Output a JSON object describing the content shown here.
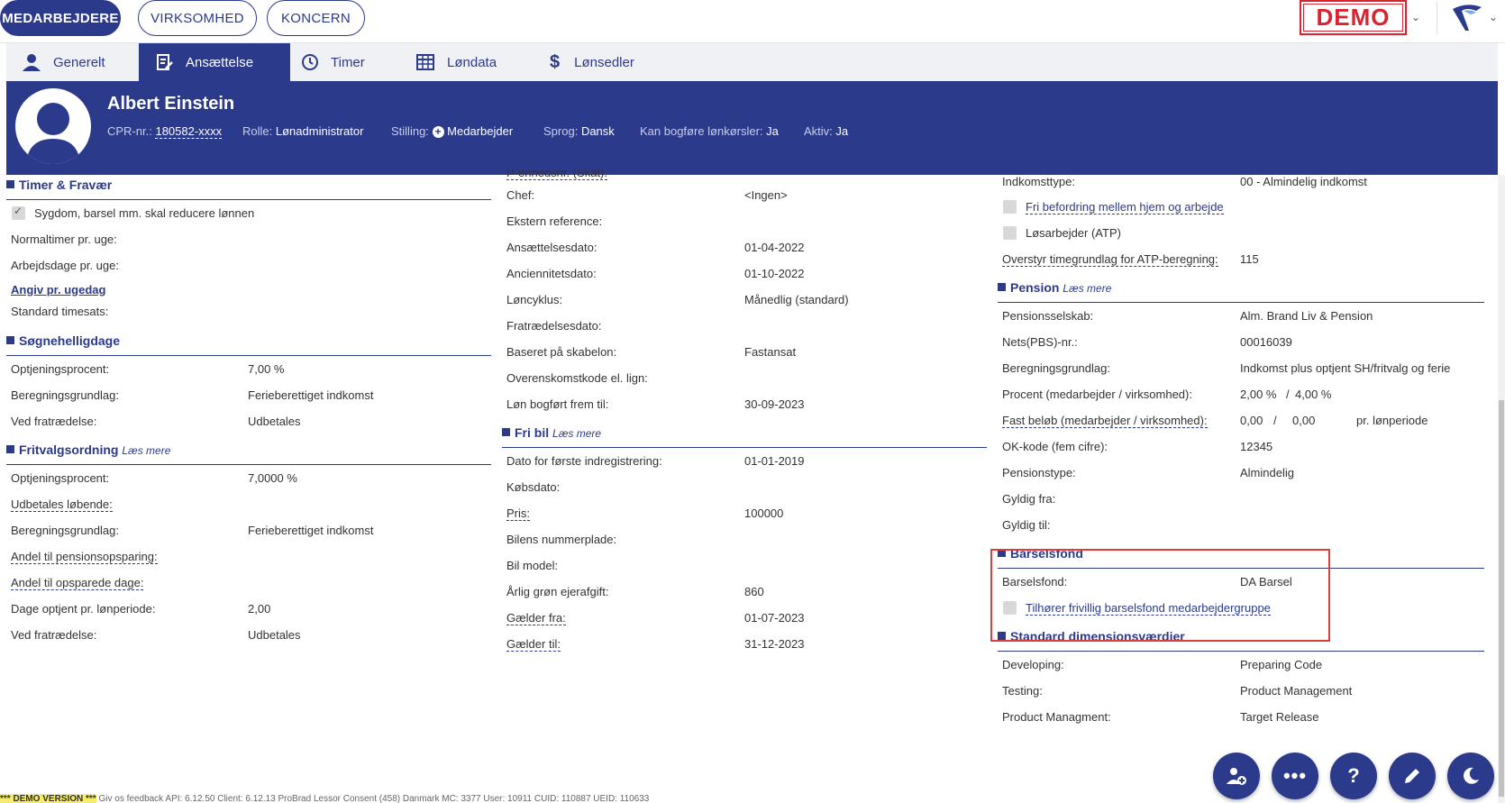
{
  "topnav": {
    "items": [
      "MEDARBEJDERE",
      "VIRKSOMHED",
      "KONCERN"
    ],
    "demo_label": "DEMO"
  },
  "tabs": [
    "Generelt",
    "Ansættelse",
    "Timer",
    "Løndata",
    "Lønsedler"
  ],
  "employee": {
    "name": "Albert Einstein",
    "cpr_label": "CPR-nr.:",
    "cpr_value": "180582-xxxx",
    "role_label": "Rolle:",
    "role_value": "Lønadministrator",
    "position_label": "Stilling:",
    "position_value": "Medarbejder",
    "language_label": "Sprog:",
    "language_value": "Dansk",
    "bookkeep_label": "Kan bogføre lønkørsler:",
    "bookkeep_value": "Ja",
    "active_label": "Aktiv:",
    "active_value": "Ja"
  },
  "col1": {
    "timer": {
      "title": "Timer & Fravær",
      "sick_checkbox": "Sygdom, barsel mm. skal reducere lønnen",
      "normal_hours": "Normaltimer pr. uge:",
      "work_days": "Arbejdsdage pr. uge:",
      "weekday_link": "Angiv pr. ugedag",
      "std_rate": "Standard timesats:"
    },
    "sh": {
      "title": "Søgnehelligdage",
      "rows": [
        {
          "label": "Optjeningsprocent:",
          "value": "7,00 %"
        },
        {
          "label": "Beregningsgrundlag:",
          "value": "Ferieberettiget indkomst"
        },
        {
          "label": "Ved fratrædelse:",
          "value": "Udbetales"
        }
      ]
    },
    "fritvalg": {
      "title": "Fritvalgsordning",
      "read_more": "Læs mere",
      "rows": [
        {
          "label": "Optjeningsprocent:",
          "value": "7,0000 %"
        },
        {
          "label": "Udbetales løbende:",
          "value": ""
        },
        {
          "label": "Beregningsgrundlag:",
          "value": "Ferieberettiget indkomst"
        },
        {
          "label": "Andel til pensionsopsparing:",
          "value": ""
        },
        {
          "label": "Andel til opsparede dage:",
          "value": ""
        },
        {
          "label": "Dage optjent pr. lønperiode:",
          "value": "2,00"
        },
        {
          "label": "Ved fratrædelse:",
          "value": "Udbetales"
        }
      ]
    }
  },
  "col2": {
    "employment": {
      "cut_label": "P-enhedsnr. (Skat):",
      "rows": [
        {
          "label": "Chef:",
          "value": "<Ingen>"
        },
        {
          "label": "Ekstern reference:",
          "value": ""
        },
        {
          "label": "Ansættelsesdato:",
          "value": "01-04-2022"
        },
        {
          "label": "Anciennitetsdato:",
          "value": "01-10-2022"
        },
        {
          "label": "Løncyklus:",
          "value": "Månedlig (standard)"
        },
        {
          "label": "Fratrædelsesdato:",
          "value": ""
        },
        {
          "label": "Baseret på skabelon:",
          "value": "Fastansat"
        },
        {
          "label": "Overenskomstkode el. lign:",
          "value": ""
        },
        {
          "label": "Løn bogført frem til:",
          "value": "30-09-2023"
        }
      ]
    },
    "car": {
      "title": "Fri bil",
      "read_more": "Læs mere",
      "rows": [
        {
          "label": "Dato for første indregistrering:",
          "value": "01-01-2019"
        },
        {
          "label": "Købsdato:",
          "value": ""
        },
        {
          "label": "Pris:",
          "value": "100000"
        },
        {
          "label": "Bilens nummerplade:",
          "value": ""
        },
        {
          "label": "Bil model:",
          "value": ""
        },
        {
          "label": "Årlig grøn ejerafgift:",
          "value": "860"
        },
        {
          "label": "Gælder fra:",
          "value": "01-07-2023"
        },
        {
          "label": "Gælder til:",
          "value": "31-12-2023"
        }
      ]
    }
  },
  "col3": {
    "income": {
      "type_label": "Indkomsttype:",
      "type_value": "00 - Almindelig indkomst",
      "free_transport": "Fri befordring mellem hjem og arbejde",
      "casual_worker": "Løsarbejder (ATP)",
      "atp_label": "Overstyr timegrundlag for ATP-beregning:",
      "atp_value": "115"
    },
    "pension": {
      "title": "Pension",
      "read_more": "Læs mere",
      "company_label": "Pensionsselskab:",
      "company_value": "Alm. Brand Liv & Pension",
      "nets_label": "Nets(PBS)-nr.:",
      "nets_value": "00016039",
      "basis_label": "Beregningsgrundlag:",
      "basis_value": "Indkomst plus optjent SH/fritvalg og ferie",
      "pct_label": "Procent (medarbejder / virksomhed):",
      "pct_emp": "2,00 %",
      "pct_sep": "/",
      "pct_comp": "4,00 %",
      "fixed_label": "Fast beløb (medarbejder / virksomhed):",
      "fixed_emp": "0,00",
      "fixed_sep": "/",
      "fixed_comp": "0,00",
      "fixed_period": "pr. lønperiode",
      "ok_label": "OK-kode (fem cifre):",
      "ok_value": "12345",
      "ptype_label": "Pensionstype:",
      "ptype_value": "Almindelig",
      "from_label": "Gyldig fra:",
      "to_label": "Gyldig til:"
    },
    "maternity": {
      "title": "Barselsfond",
      "fund_label": "Barselsfond:",
      "fund_value": "DA Barsel",
      "voluntary": "Tilhører frivillig barselsfond medarbejdergruppe"
    },
    "dimensions": {
      "title": "Standard dimensionsværdier",
      "rows": [
        {
          "label": "Developing:",
          "value": "Preparing Code"
        },
        {
          "label": "Testing:",
          "value": "Product Management"
        },
        {
          "label": "Product Managment:",
          "value": "Target Release"
        }
      ]
    }
  },
  "footer": {
    "demo_version": "*** DEMO VERSION ***",
    "text": " Giv os feedback   API: 6.12.50   Client: 6.12.13   ProBrad   Lessor Consent (458)   Danmark   MC: 3377   User: 10911   CUID: 110887   UEID: 110633"
  },
  "colors": {
    "primary": "#2c3a8c",
    "demo_red": "#d9232e",
    "highlight": "#e23b3b"
  }
}
